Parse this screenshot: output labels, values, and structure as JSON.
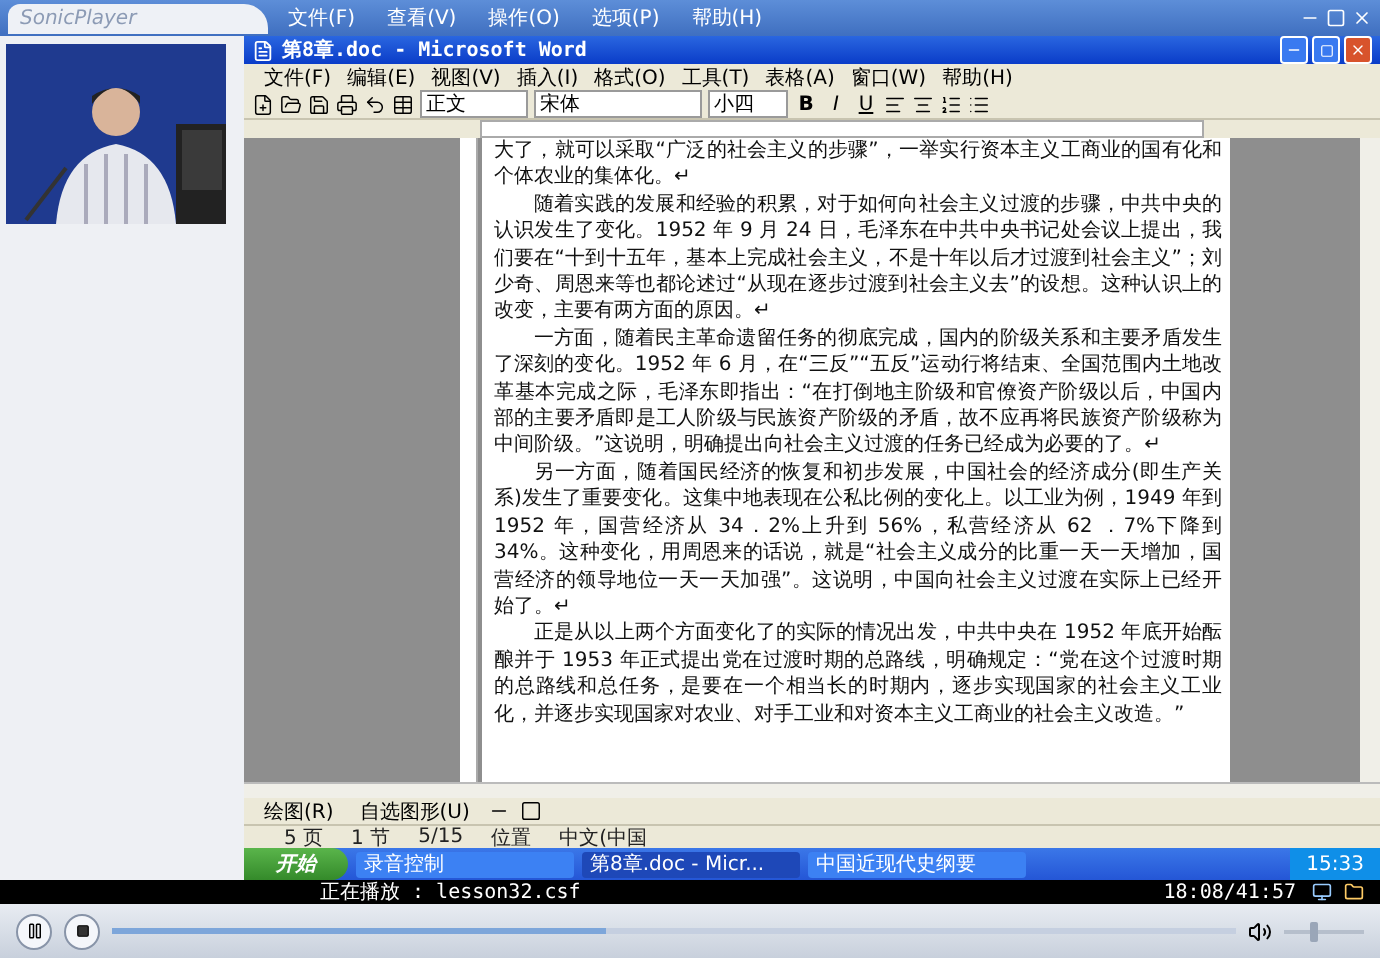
{
  "player": {
    "title": "SonicPlayer",
    "menu": [
      "文件(F)",
      "查看(V)",
      "操作(O)",
      "选项(P)",
      "帮助(H)"
    ],
    "status": "正在播放 : lesson32.csf",
    "time": "18:08/41:57",
    "progress": {
      "level": 0.44
    },
    "volume": {
      "level": 0.35
    }
  },
  "word": {
    "title": "第8章.doc - Microsoft Word",
    "menu": [
      "文件(F)",
      "编辑(E)",
      "视图(V)",
      "插入(I)",
      "格式(O)",
      "工具(T)",
      "表格(A)",
      "窗口(W)",
      "帮助(H)"
    ],
    "style": "正文",
    "font": "宋体",
    "size": "小四",
    "format_buttons": [
      {
        "label": "B",
        "kind": "bold"
      },
      {
        "label": "I",
        "kind": "italic"
      },
      {
        "label": "U",
        "kind": "underline"
      }
    ],
    "paragraphs": [
      {
        "text": "大了，就可以采取“广泛的社会主义的步骤”，一举实行资本主义工商业的国有化和个体农业的集体化。↵",
        "indent": false
      },
      {
        "text": "随着实践的发展和经验的积累，对于如何向社会主义过渡的步骤，中共中央的认识发生了变化。1952 年 9 月 24 日，毛泽东在中共中央书记处会议上提出，我们要在“十到十五年，基本上完成社会主义，不是十年以后才过渡到社会主义”；刘少奇、周恩来等也都论述过“从现在逐步过渡到社会主义去”的设想。这种认识上的改变，主要有两方面的原因。↵",
        "indent": true
      },
      {
        "text": "一方面，随着民主革命遗留任务的彻底完成，国内的阶级关系和主要矛盾发生了深刻的变化。1952 年 6 月，在“三反”“五反”运动行将结束、全国范围内土地改革基本完成之际，毛泽东即指出：“在打倒地主阶级和官僚资产阶级以后，中国内部的主要矛盾即是工人阶级与民族资产阶级的矛盾，故不应再将民族资产阶级称为中间阶级。”这说明，明确提出向社会主义过渡的任务已经成为必要的了。↵",
        "indent": true
      },
      {
        "text": "另一方面，随着国民经济的恢复和初步发展，中国社会的经济成分(即生产关系)发生了重要变化。这集中地表现在公私比例的变化上。以工业为例，1949 年到 1952 年，国营经济从 34．2%上升到 56%，私营经济从 62 ．7%下降到 34%。这种变化，用周恩来的话说，就是“社会主义成分的比重一天一天增加，国营经济的领导地位一天一天加强”。这说明，中国向社会主义过渡在实际上已经开始了。↵",
        "indent": true
      },
      {
        "text": "正是从以上两个方面变化了的实际的情况出发，中共中央在 1952 年底开始酝酿并于 1953 年正式提出党在过渡时期的总路线，明确规定：“党在这个过渡时期的总路线和总任务，是要在一个相当长的时期内，逐步实现国家的社会主义工业化，并逐步实现国家对农业、对手工业和对资本主义工商业的社会主义改造。”",
        "indent": true
      }
    ],
    "draw_menu": "绘图(R)",
    "autoshape_menu": "自选图形(U)",
    "status_bar": [
      "5 页",
      "1 节",
      "5/15",
      "位置",
      "中文(中国"
    ]
  },
  "taskbar": {
    "start": "开始",
    "tasks": [
      {
        "label": "录音控制",
        "selected": false
      },
      {
        "label": "第8章.doc - Micr...",
        "selected": true
      },
      {
        "label": "中国近现代史纲要",
        "selected": false
      }
    ],
    "clock": "15:33"
  }
}
